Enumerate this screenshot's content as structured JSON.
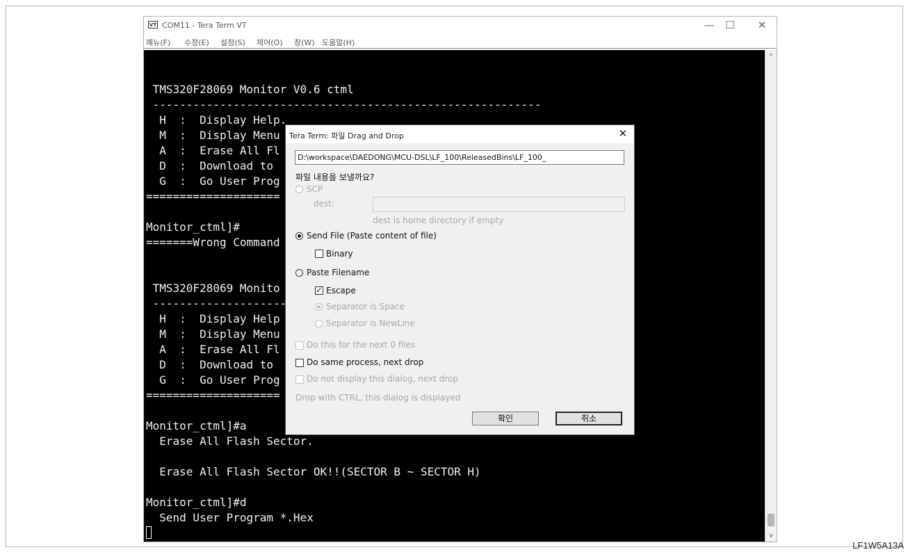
{
  "window": {
    "icon_text": "VT",
    "title": "COM11 - Tera Term VT",
    "minimize": "—",
    "maximize": "☐",
    "close": "✕"
  },
  "menu": [
    "메뉴(F)",
    "수정(E)",
    "설정(S)",
    "제어(O)",
    "창(W)",
    "도움말(H)"
  ],
  "terminal": {
    "lines": [
      "",
      "",
      " TMS320F28069 Monitor V0.6 ctml",
      " ----------------------------------------------------------",
      "  H  :  Display Help.",
      "  M  :  Display Menu",
      "  A  :  Erase All Fl",
      "  D  :  Download to",
      "  G  :  Go User Prog",
      "====================",
      "",
      "Monitor_ctml]#",
      "=======Wrong Command",
      "",
      "",
      " TMS320F28069 Monito",
      " --------------------",
      "  H  :  Display Help",
      "  M  :  Display Menu",
      "  A  :  Erase All Fl",
      "  D  :  Download to",
      "  G  :  Go User Prog",
      "====================",
      "",
      "Monitor_ctml]#a",
      "  Erase All Flash Sector.",
      "",
      "  Erase All Flash Sector OK!!(SECTOR B ~ SECTOR H)",
      "",
      "Monitor_ctml]#d",
      "  Send User Program *.Hex"
    ]
  },
  "scrollbar": {
    "up": "^",
    "down": "v"
  },
  "dialog": {
    "title": "Tera Term: 파일 Drag and Drop",
    "close": "✕",
    "path": "D:\\workspace\\DAEDONG\\MCU-DSL\\LF_100\\ReleasedBins\\LF_100_",
    "question": "파일 내용을 보낼까요?",
    "scp_label": "SCP",
    "dest_label": "dest:",
    "dest_hint": "dest is home directory if empty",
    "send_file_label": "Send File (Paste content of file)",
    "binary_label": "Binary",
    "paste_filename_label": "Paste Filename",
    "escape_label": "Escape",
    "escape_mark": "✓",
    "sep_space_label": "Separator is Space",
    "sep_newline_label": "Separator is NewLine",
    "do_next_label": "Do this for the next 0 files",
    "same_process_label": "Do same process, next drop",
    "not_display_label": "Do not display this dialog, next drop",
    "ctrl_hint": "Drop with CTRL, this dialog is displayed",
    "ok_label": "확인",
    "cancel_label": "취소"
  },
  "caption": "LF1W5A13A"
}
